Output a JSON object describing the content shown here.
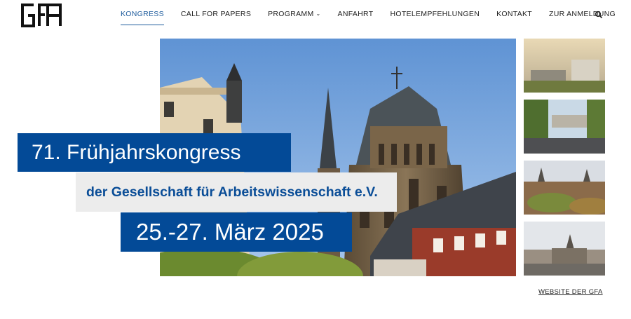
{
  "header": {
    "logo_text": "GfA",
    "nav": [
      {
        "label": "KONGRESS",
        "active": true
      },
      {
        "label": "CALL FOR PAPERS"
      },
      {
        "label": "PROGRAMM",
        "dropdown": true
      },
      {
        "label": "ANFAHRT"
      },
      {
        "label": "HOTELEMPFEHLUNGEN"
      },
      {
        "label": "KONTAKT"
      },
      {
        "label": "ZUR ANMELDUNG"
      }
    ],
    "search_icon": "search-icon",
    "accent_color": "#1c5a9c"
  },
  "hero": {
    "line1": "71. Frühjahrskongress",
    "line2": "der Gesellschaft für Arbeitswissenschaft e.V.",
    "line3": "25.-27. März 2025",
    "box_color": "#034a97",
    "box2_color": "#ececec"
  },
  "thumbnails": [
    "thumb-campus",
    "thumb-building",
    "thumb-city",
    "thumb-cathedral"
  ],
  "footer": {
    "link_label": "WEBSITE DER GFA"
  }
}
